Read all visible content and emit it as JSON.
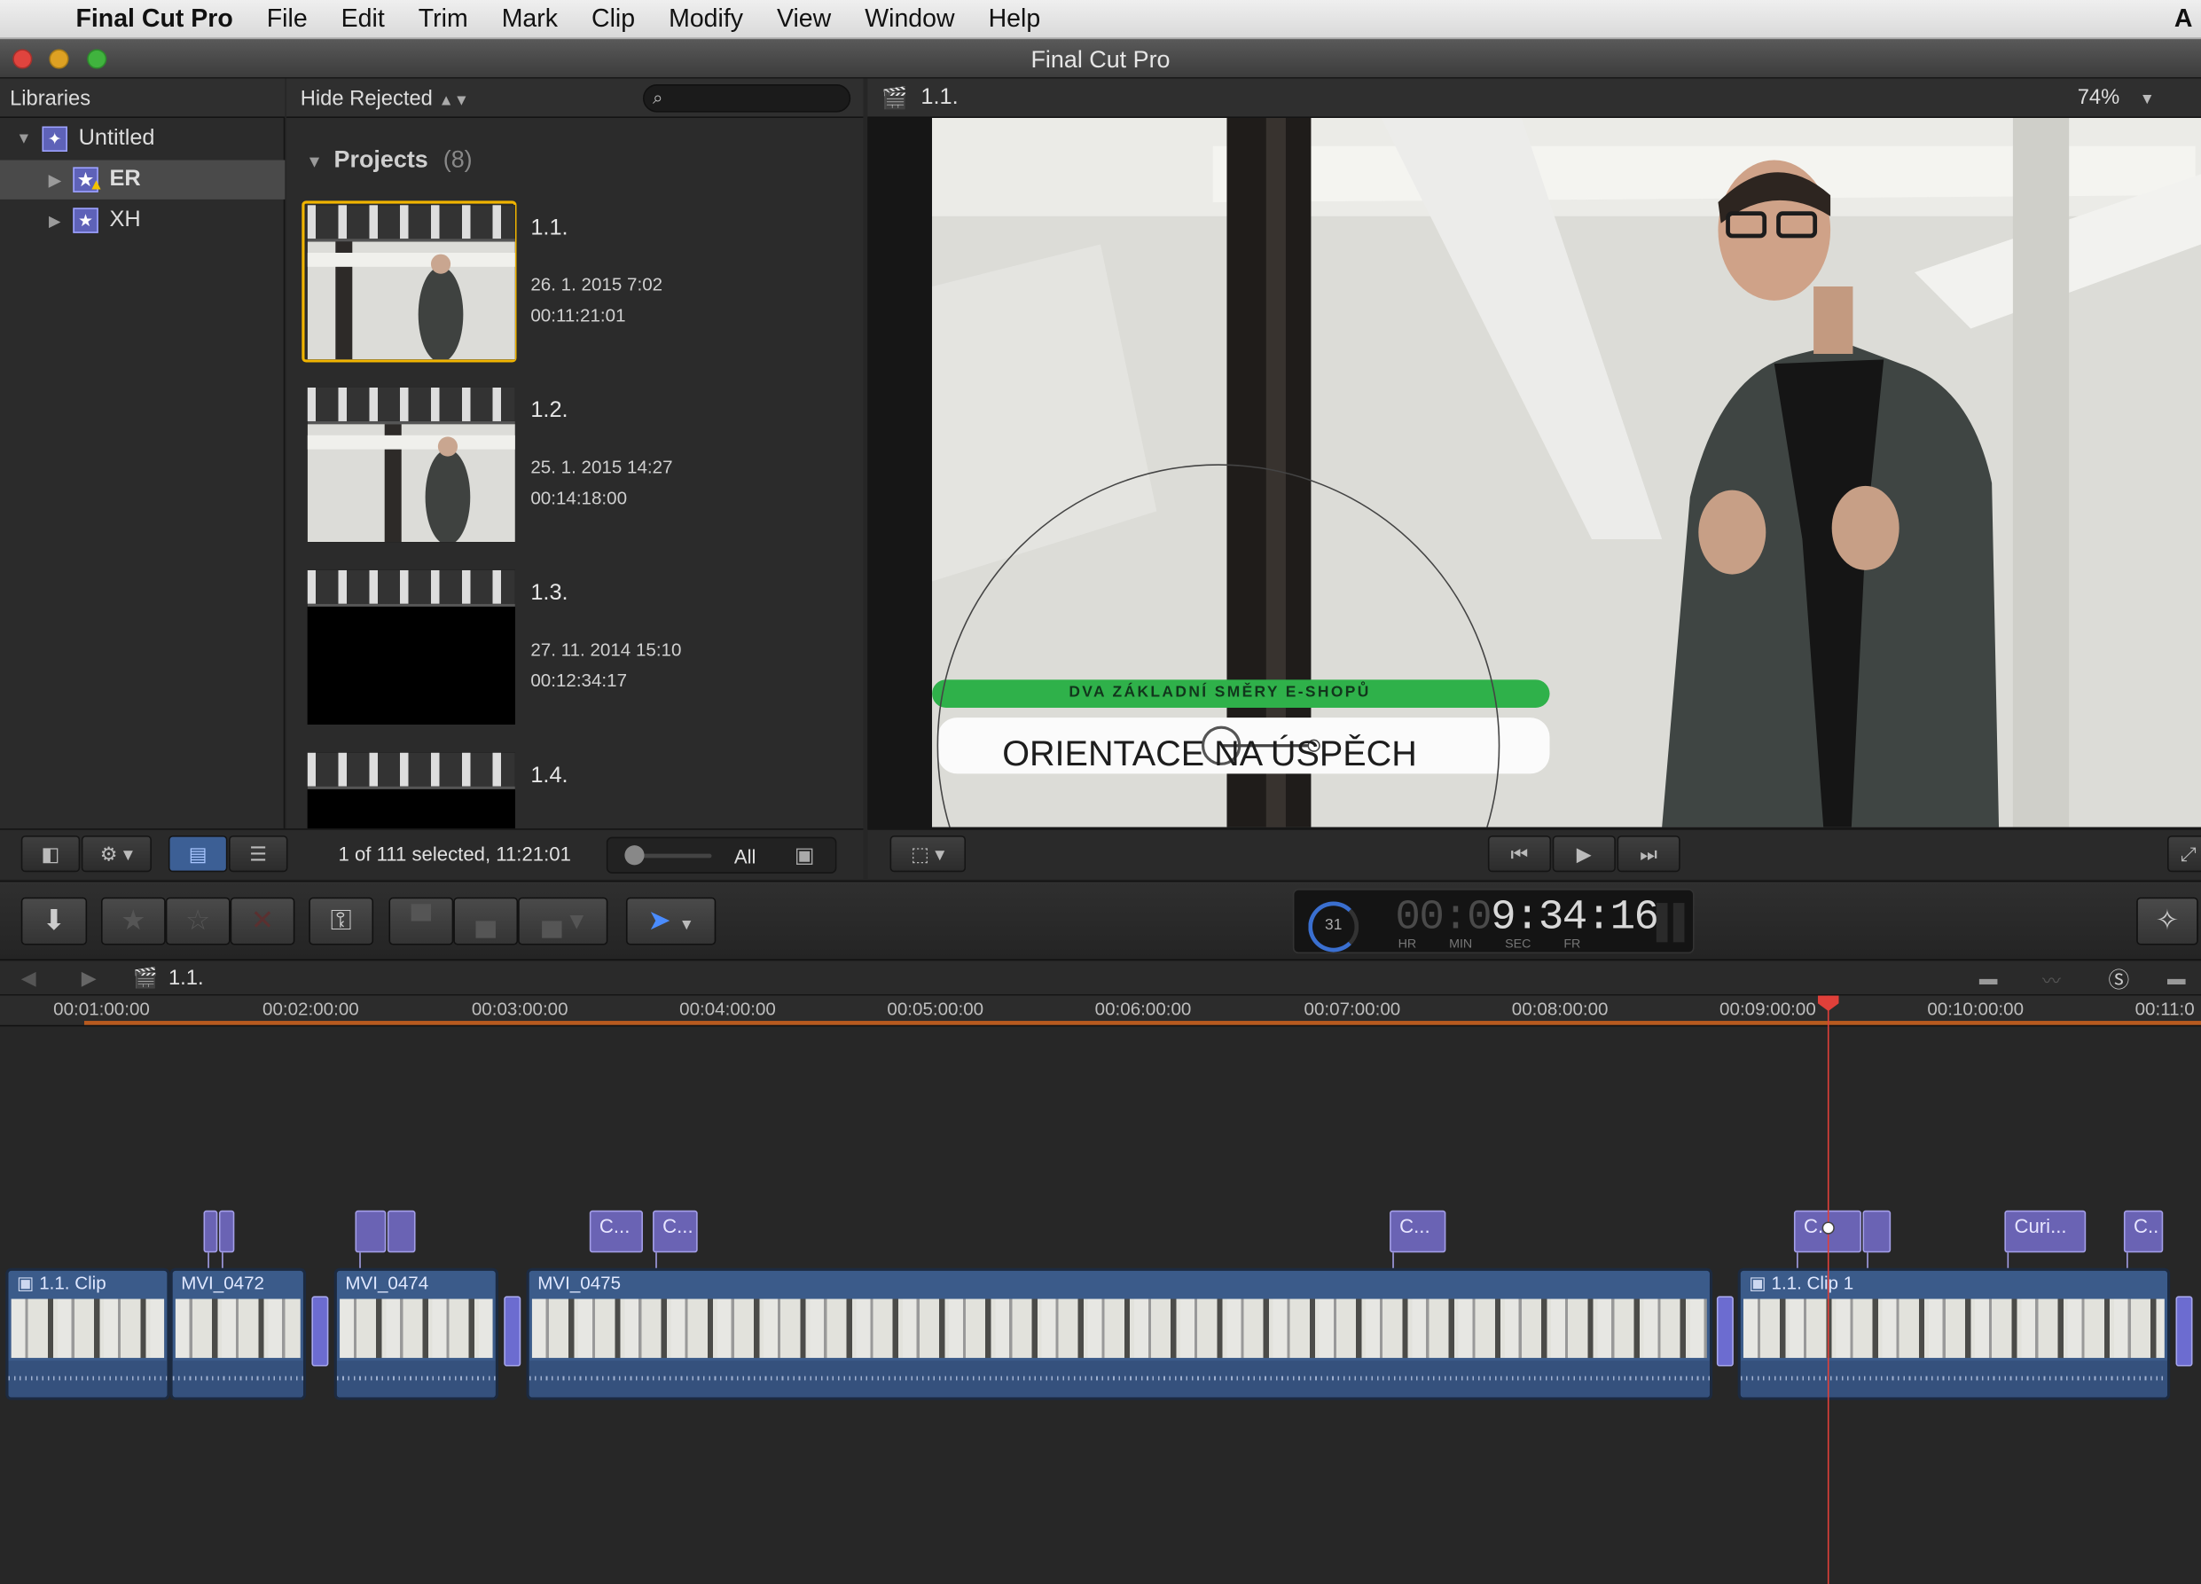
{
  "menubar": {
    "app": "Final Cut Pro",
    "items": [
      "File",
      "Edit",
      "Trim",
      "Mark",
      "Clip",
      "Modify",
      "View",
      "Window",
      "Help"
    ]
  },
  "window": {
    "title": "Final Cut Pro"
  },
  "libraries": {
    "header": "Libraries",
    "items": [
      {
        "label": "Untitled",
        "level": 0,
        "expanded": true
      },
      {
        "label": "ER",
        "level": 1,
        "selected": true
      },
      {
        "label": "XH",
        "level": 1
      }
    ]
  },
  "browser": {
    "filter": "Hide Rejected",
    "search_placeholder": "",
    "section": "Projects",
    "count": "(8)",
    "projects": [
      {
        "title": "1.1.",
        "date": "26. 1. 2015 7:02",
        "duration": "00:11:21:01"
      },
      {
        "title": "1.2.",
        "date": "25. 1. 2015 14:27",
        "duration": "00:14:18:00"
      },
      {
        "title": "1.3.",
        "date": "27. 11. 2014 15:10",
        "duration": "00:12:34:17"
      },
      {
        "title": "1.4.",
        "date": "",
        "duration": ""
      }
    ],
    "status": "1 of 111 selected, 11:21:01",
    "all_label": "All"
  },
  "viewer": {
    "title": "1.1.",
    "zoom": "74%",
    "lower_third_top": "DVA ZÁKLADNÍ SMĚRY E-SHOPŮ",
    "lower_third_main": "ORIENTACE NA ÚSPĚCH"
  },
  "timecode": {
    "value": "00:09:34:16",
    "dim": "00:0",
    "bright": "9:34:16",
    "percent": "31",
    "units": [
      "HR",
      "MIN",
      "SEC",
      "FR"
    ]
  },
  "timeline": {
    "project": "1.1.",
    "ruler": [
      "00:01:00:00",
      "00:02:00:00",
      "00:03:00:00",
      "00:04:00:00",
      "00:05:00:00",
      "00:06:00:00",
      "00:07:00:00",
      "00:08:00:00",
      "00:09:00:00",
      "00:10:00:00",
      "00:11:0"
    ],
    "clips": [
      "1.1. Clip",
      "MVI_0472",
      "MVI_0474",
      "MVI_0475",
      "1.1. Clip 1"
    ],
    "connected": [
      "",
      "",
      "",
      "",
      "C...",
      "C...",
      "C...",
      "C...",
      "",
      "Curi...",
      "C.."
    ]
  },
  "colors": {
    "accent": "#f0b400",
    "playhead": "#e0403a",
    "clip": "#3b5b8a",
    "title_clip": "#6a63b4",
    "green_bar": "#2fb14a"
  }
}
